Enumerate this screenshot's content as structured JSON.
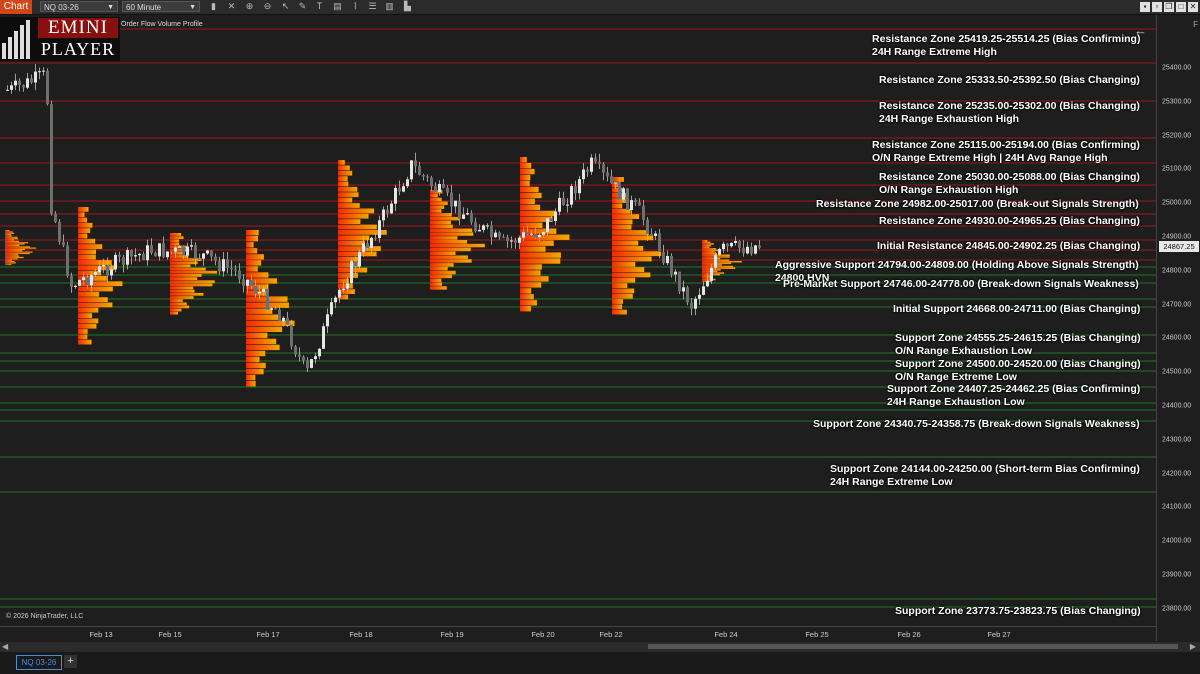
{
  "toolbar": {
    "tab_label": "Chart",
    "instrument": "NQ 03-26",
    "interval": "60 Minute",
    "tools": [
      "bar-type-icon",
      "crosshair-icon",
      "zoom-in-icon",
      "zoom-out-icon",
      "pointer-icon",
      "pencil-icon",
      "text-icon",
      "data-box-icon",
      "strategy-icon",
      "properties-icon",
      "order-book-icon",
      "volume-icon"
    ],
    "window_controls": [
      "link-icon",
      "minimize-icon",
      "restore-icon",
      "maximize-icon",
      "close-icon"
    ]
  },
  "chart": {
    "indicator_label": "Order Flow Volume Profile",
    "logo_line1": "EMINI",
    "logo_line2": "PLAYER",
    "copyright": "© 2026 NinjaTrader, LLC",
    "panel_flag": "F",
    "back_arrow": "←",
    "current_price": "24867.25",
    "price_ticks": [
      "25400.00",
      "25300.00",
      "25200.00",
      "25100.00",
      "25000.00",
      "24900.00",
      "24800.00",
      "24700.00",
      "24600.00",
      "24500.00",
      "24400.00",
      "24300.00",
      "24200.00",
      "24100.00",
      "24000.00",
      "23900.00",
      "23800.00"
    ],
    "date_ticks": [
      "Feb 13",
      "Feb 15",
      "Feb 17",
      "Feb 18",
      "Feb 19",
      "Feb 20",
      "Feb 22",
      "Feb 24",
      "Feb 25",
      "Feb 26",
      "Feb 27"
    ],
    "zones": [
      {
        "lines": [
          "Resistance Zone 25419.25-25514.25 (Bias Confirming)",
          "24H Range Extreme High"
        ]
      },
      {
        "lines": [
          "Resistance Zone 25333.50-25392.50 (Bias Changing)"
        ]
      },
      {
        "lines": [
          "Resistance Zone 25235.00-25302.00 (Bias Changing)",
          "24H Range Exhaustion High"
        ]
      },
      {
        "lines": [
          "Resistance Zone 25115.00-25194.00 (Bias Confirming)",
          "O/N Range Extreme High | 24H Avg Range High"
        ]
      },
      {
        "lines": [
          "Resistance Zone 25030.00-25088.00 (Bias Changing)",
          "O/N Range Exhaustion High"
        ]
      },
      {
        "lines": [
          "Resistance Zone 24982.00-25017.00 (Break-out Signals Strength)"
        ]
      },
      {
        "lines": [
          "Resistance Zone 24930.00-24965.25 (Bias Changing)"
        ]
      },
      {
        "lines": [
          "Initial Resistance 24845.00-24902.25 (Bias Changing)"
        ]
      },
      {
        "lines": [
          "Aggressive Support 24794.00-24809.00 (Holding Above Signals Strength)",
          "24800 HVN"
        ]
      },
      {
        "lines": [
          "Pre-Market Support 24746.00-24778.00 (Break-down Signals Weakness)"
        ]
      },
      {
        "lines": [
          "Initial Support 24668.00-24711.00 (Bias Changing)"
        ]
      },
      {
        "lines": [
          "Support Zone 24555.25-24615.25 (Bias Changing)",
          "O/N Range Exhaustion Low"
        ]
      },
      {
        "lines": [
          "Support Zone 24500.00-24520.00 (Bias Changing)",
          "O/N Range Extreme Low"
        ]
      },
      {
        "lines": [
          "Support Zone 24407.25-24462.25 (Bias Confirming)",
          "24H Range Exhaustion Low"
        ]
      },
      {
        "lines": [
          "Support Zone 24340.75-24358.75 (Break-down Signals Weakness)"
        ]
      },
      {
        "lines": [
          "Support Zone 24144.00-24250.00 (Short-term Bias Confirming)",
          "24H Range Extreme Low"
        ]
      },
      {
        "lines": [
          "Support Zone 23773.75-23823.75 (Bias Changing)"
        ]
      }
    ],
    "colors": {
      "resistance": "#a01818",
      "support": "#1f7a1f",
      "candle_up": "#bfbfbf",
      "candle_down": "#bfbfbf",
      "profile_hot": "#ff2a00",
      "profile_warm": "#ffb000",
      "badge": "#e8e8e8"
    }
  },
  "bottom": {
    "tab_label": "NQ 03-26",
    "add_tab": "+"
  }
}
